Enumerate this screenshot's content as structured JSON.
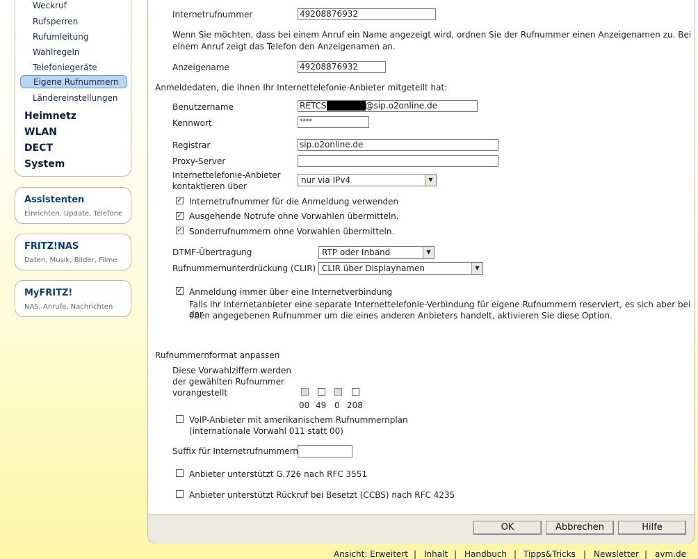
{
  "sidebar": {
    "phone_items": [
      "Weckruf",
      "Rufsperren",
      "Rufumleitung",
      "Wahlregeln",
      "Telefoniegeräte",
      "Eigene Rufnummern",
      "Ländereinstellungen"
    ],
    "main_items": [
      "Heimnetz",
      "WLAN",
      "DECT",
      "System"
    ],
    "boxes": [
      {
        "title": "Assistenten",
        "subtitle": "Einrichten, Update, Telefone"
      },
      {
        "title": "FRITZ!NAS",
        "subtitle": "Daten, Musik, Bilder, Filme"
      },
      {
        "title": "MyFRITZ!",
        "subtitle": "NAS, Anrufe, Nachrichten"
      }
    ]
  },
  "form": {
    "internet_number_label": "Internetrufnummer",
    "internet_number_value": "49208876932",
    "name_hint_line1": "Wenn Sie möchten, dass bei einem Anruf ein Name angezeigt wird, ordnen Sie der Rufnummer einen Anzeigenamen zu. Bei",
    "name_hint_line2": "einem Anruf zeigt das Telefon den Anzeigenamen an.",
    "display_name_label": "Anzeigename",
    "display_name_value": "49208876932",
    "login_heading": "Anmeldedaten, die Ihnen Ihr Internettelefonie-Anbieter mitgeteilt hat:",
    "username_label": "Benutzername",
    "username_prefix": "RETCS",
    "username_suffix": "@sip.o2online.de",
    "password_label": "Kennwort",
    "password_value": "****",
    "registrar_label": "Registrar",
    "registrar_value": "sip.o2online.de",
    "proxy_label": "Proxy-Server",
    "proxy_value": "",
    "contact_label_1": "Internettelefonie-Anbieter",
    "contact_label_2": "kontaktieren über",
    "contact_value": "nur via IPv4",
    "cb_use_number": "Internetrufnummer für die Anmeldung verwenden",
    "cb_emergency": "Ausgehende Notrufe ohne Vorwahlen übermitteln.",
    "cb_special": "Sonderrufnummern ohne Vorwahlen übermitteln.",
    "dtmf_label": "DTMF-Übertragung",
    "dtmf_value": "RTP oder Inband",
    "clir_label": "Rufnummernunterdrückung (CLIR)",
    "clir_value": "CLIR über Displaynamen",
    "cb_always_internet": "Anmeldung immer über eine Internetverbindung",
    "always_hint_line1": "Falls Ihr Internetanbieter eine separate Internettelefonie-Verbindung für eigene Rufnummern reserviert, es sich aber bei der",
    "always_hint_line2": "oben angegebenen Rufnummer um die eines anderen Anbieters handelt, aktivieren Sie diese Option.",
    "format_heading": "Rufnummernformat anpassen",
    "prefix_label_1": "Diese Vorwahlziffern werden",
    "prefix_label_2": "der gewählten Rufnummer",
    "prefix_label_3": "vorangestellt",
    "prefix_options": [
      "00",
      "49",
      "0",
      "208"
    ],
    "cb_voip_us_1": "VoIP-Anbieter mit amerikanischem Rufnummernplan",
    "cb_voip_us_2": "(internationale Vorwahl 011 statt 00)",
    "suffix_label": "Suffix für Internetrufnummern",
    "suffix_value": "",
    "cb_g726": "Anbieter unterstützt G.726 nach RFC 3551",
    "cb_ccbs": "Anbieter unterstützt Rückruf bei Besetzt (CCBS) nach RFC 4235"
  },
  "buttons": {
    "ok": "OK",
    "cancel": "Abbrechen",
    "help": "Hilfe"
  },
  "footer": {
    "view": "Ansicht: Erweitert",
    "contents": "Inhalt",
    "manual": "Handbuch",
    "tips": "Tipps&Tricks",
    "newsletter": "Newsletter",
    "site": "avm.de",
    "sep": "|"
  }
}
